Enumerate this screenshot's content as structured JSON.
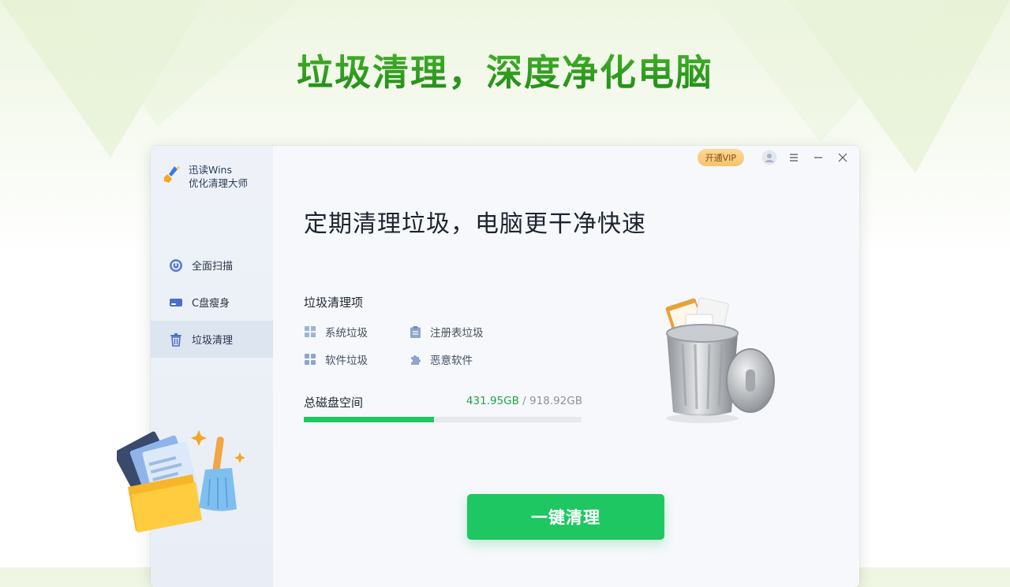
{
  "hero": {
    "title": "垃圾清理，深度净化电脑"
  },
  "app": {
    "brand_line1": "迅读Wins",
    "brand_line2": "优化清理大师",
    "vip_label": "开通VIP"
  },
  "sidebar": {
    "items": [
      {
        "label": "全面扫描",
        "icon": "scan-icon",
        "active": false
      },
      {
        "label": "C盘瘦身",
        "icon": "disk-icon",
        "active": false
      },
      {
        "label": "垃圾清理",
        "icon": "trash-icon",
        "active": true
      }
    ]
  },
  "main": {
    "headline": "定期清理垃圾，电脑更干净快速",
    "section_title": "垃圾清理项",
    "items": [
      {
        "label": "系统垃圾",
        "icon": "windows-icon"
      },
      {
        "label": "注册表垃圾",
        "icon": "clipboard-icon"
      },
      {
        "label": "软件垃圾",
        "icon": "apps-grid-icon"
      },
      {
        "label": "恶意软件",
        "icon": "puzzle-icon"
      }
    ],
    "disk_label": "总磁盘空间",
    "disk_used": "431.95GB",
    "disk_sep": " / ",
    "disk_total": "918.92GB",
    "disk_fraction": 0.47,
    "cta_label": "一键清理"
  },
  "colors": {
    "accent_green": "#1ec762",
    "used_text": "#22a147",
    "title_green": "#2c9a1e",
    "vip_bg": "#f5c36e"
  }
}
